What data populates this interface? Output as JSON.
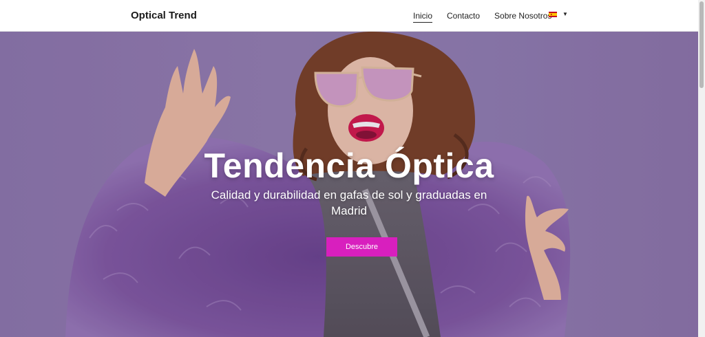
{
  "header": {
    "brand": "Optical Trend",
    "nav": [
      {
        "label": "Inicio",
        "active": true
      },
      {
        "label": "Contacto",
        "active": false
      },
      {
        "label": "Sobre Nosotros",
        "active": false
      }
    ],
    "language": {
      "flag_icon": "spain-flag-icon",
      "caret_icon": "caret-down-icon",
      "caret_glyph": "▼"
    }
  },
  "hero": {
    "title": "Tendencia Óptica",
    "subtitle": "Calidad y durabilidad en gafas de sol y graduadas en Madrid",
    "cta_label": "Descubre",
    "image": "woman-sunglasses-purple-fur-photo"
  },
  "colors": {
    "cta": "#d81fbe",
    "hero_background": "#9682b4",
    "fur": "#7a4f9a",
    "text_dark": "#1a1a1a"
  }
}
